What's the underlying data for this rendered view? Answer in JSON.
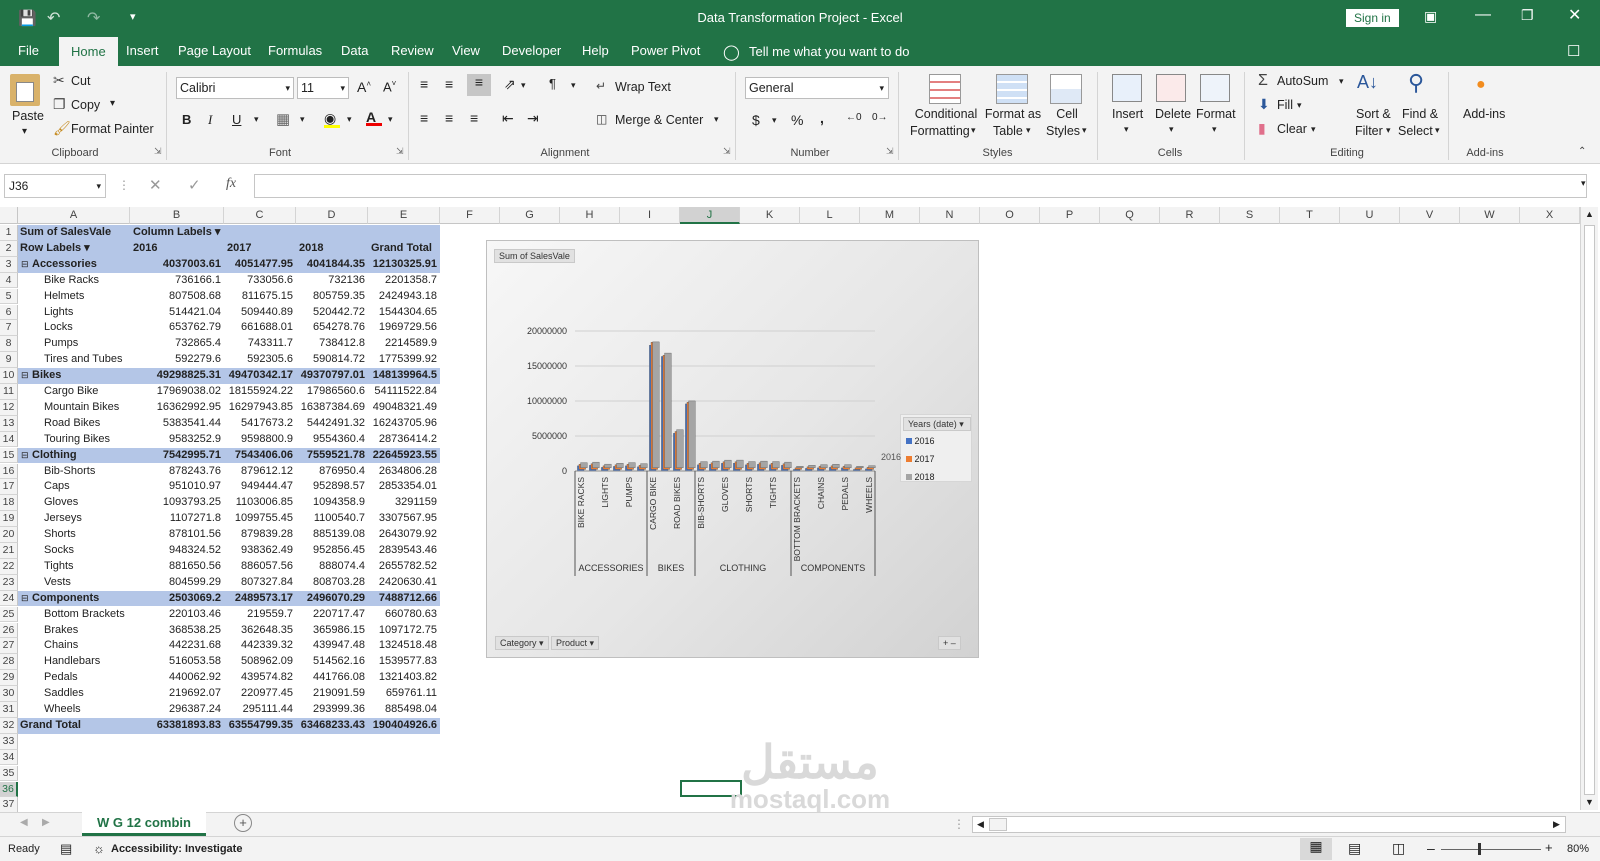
{
  "app": {
    "title": "Data Transformation Project  -  Excel",
    "signin": "Sign in"
  },
  "menu": {
    "tabs": [
      "File",
      "Home",
      "Insert",
      "Page Layout",
      "Formulas",
      "Data",
      "Review",
      "View",
      "Developer",
      "Help",
      "Power Pivot"
    ],
    "tell_me": "Tell me what you want to do"
  },
  "ribbon": {
    "clipboard": {
      "paste": "Paste",
      "cut": "Cut",
      "copy": "Copy",
      "format_painter": "Format Painter",
      "label": "Clipboard"
    },
    "font": {
      "name": "Calibri",
      "size": "11",
      "bold": "B",
      "italic": "I",
      "underline": "U",
      "label": "Font"
    },
    "alignment": {
      "wrap": "Wrap Text",
      "merge": "Merge & Center",
      "label": "Alignment"
    },
    "number": {
      "format": "General",
      "currency": "$",
      "percent": "%",
      "comma": ",",
      "label": "Number"
    },
    "styles": {
      "cond1": "Conditional",
      "cond2": "Formatting",
      "fmt1": "Format as",
      "fmt2": "Table",
      "cell1": "Cell",
      "cell2": "Styles",
      "label": "Styles"
    },
    "cells": {
      "insert": "Insert",
      "delete": "Delete",
      "format": "Format",
      "label": "Cells"
    },
    "editing": {
      "autosum": "AutoSum",
      "fill": "Fill",
      "clear": "Clear",
      "sort1": "Sort &",
      "sort2": "Filter",
      "find1": "Find &",
      "find2": "Select",
      "label": "Editing"
    },
    "addins": {
      "btn": "Add-ins",
      "label": "Add-ins"
    }
  },
  "formula": {
    "namebox": "J36",
    "fx": "fx"
  },
  "columns": [
    "A",
    "B",
    "C",
    "D",
    "E",
    "F",
    "G",
    "H",
    "I",
    "J",
    "K",
    "L",
    "M",
    "N",
    "O",
    "P",
    "Q",
    "R",
    "S",
    "T",
    "U",
    "V",
    "W",
    "X"
  ],
  "rows": [
    "1",
    "2",
    "3",
    "4",
    "5",
    "6",
    "7",
    "8",
    "9",
    "10",
    "11",
    "12",
    "13",
    "14",
    "15",
    "16",
    "17",
    "18",
    "19",
    "20",
    "21",
    "22",
    "23",
    "24",
    "25",
    "26",
    "27",
    "28",
    "29",
    "30",
    "31",
    "32",
    "33",
    "34",
    "35",
    "36",
    "37"
  ],
  "pivot": {
    "r1": [
      "Sum of SalesVale",
      "Column Labels"
    ],
    "r2": [
      "Row Labels",
      "2016",
      "2017",
      "2018",
      "Grand Total"
    ],
    "body": [
      [
        "Accessories",
        "4037003.61",
        "4051477.95",
        "4041844.35",
        "12130325.91",
        "g"
      ],
      [
        "Bike Racks",
        "736166.1",
        "733056.6",
        "732136",
        "2201358.7",
        "i"
      ],
      [
        "Helmets",
        "807508.68",
        "811675.15",
        "805759.35",
        "2424943.18",
        "i"
      ],
      [
        "Lights",
        "514421.04",
        "509440.89",
        "520442.72",
        "1544304.65",
        "i"
      ],
      [
        "Locks",
        "653762.79",
        "661688.01",
        "654278.76",
        "1969729.56",
        "i"
      ],
      [
        "Pumps",
        "732865.4",
        "743311.7",
        "738412.8",
        "2214589.9",
        "i"
      ],
      [
        "Tires and Tubes",
        "592279.6",
        "592305.6",
        "590814.72",
        "1775399.92",
        "i"
      ],
      [
        "Bikes",
        "49298825.31",
        "49470342.17",
        "49370797.01",
        "148139964.5",
        "g"
      ],
      [
        "Cargo Bike",
        "17969038.02",
        "18155924.22",
        "17986560.6",
        "54111522.84",
        "i"
      ],
      [
        "Mountain Bikes",
        "16362992.95",
        "16297943.85",
        "16387384.69",
        "49048321.49",
        "i"
      ],
      [
        "Road Bikes",
        "5383541.44",
        "5417673.2",
        "5442491.32",
        "16243705.96",
        "i"
      ],
      [
        "Touring Bikes",
        "9583252.9",
        "9598800.9",
        "9554360.4",
        "28736414.2",
        "i"
      ],
      [
        "Clothing",
        "7542995.71",
        "7543406.06",
        "7559521.78",
        "22645923.55",
        "g"
      ],
      [
        "Bib-Shorts",
        "878243.76",
        "879612.12",
        "876950.4",
        "2634806.28",
        "i"
      ],
      [
        "Caps",
        "951010.97",
        "949444.47",
        "952898.57",
        "2853354.01",
        "i"
      ],
      [
        "Gloves",
        "1093793.25",
        "1103006.85",
        "1094358.9",
        "3291159",
        "i"
      ],
      [
        "Jerseys",
        "1107271.8",
        "1099755.45",
        "1100540.7",
        "3307567.95",
        "i"
      ],
      [
        "Shorts",
        "878101.56",
        "879839.28",
        "885139.08",
        "2643079.92",
        "i"
      ],
      [
        "Socks",
        "948324.52",
        "938362.49",
        "952856.45",
        "2839543.46",
        "i"
      ],
      [
        "Tights",
        "881650.56",
        "886057.56",
        "888074.4",
        "2655782.52",
        "i"
      ],
      [
        "Vests",
        "804599.29",
        "807327.84",
        "808703.28",
        "2420630.41",
        "i"
      ],
      [
        "Components",
        "2503069.2",
        "2489573.17",
        "2496070.29",
        "7488712.66",
        "g"
      ],
      [
        "Bottom Brackets",
        "220103.46",
        "219559.7",
        "220717.47",
        "660780.63",
        "i"
      ],
      [
        "Brakes",
        "368538.25",
        "362648.35",
        "365986.15",
        "1097172.75",
        "i"
      ],
      [
        "Chains",
        "442231.68",
        "442339.32",
        "439947.48",
        "1324518.48",
        "i"
      ],
      [
        "Handlebars",
        "516053.58",
        "508962.09",
        "514562.16",
        "1539577.83",
        "i"
      ],
      [
        "Pedals",
        "440062.92",
        "439574.82",
        "441766.08",
        "1321403.82",
        "i"
      ],
      [
        "Saddles",
        "219692.07",
        "220977.45",
        "219091.59",
        "659761.11",
        "i"
      ],
      [
        "Wheels",
        "296387.24",
        "295111.44",
        "293999.36",
        "885498.04",
        "i"
      ],
      [
        "Grand Total",
        "63381893.83",
        "63554799.35",
        "63468233.43",
        "190404926.6",
        "t"
      ]
    ]
  },
  "chart_data": {
    "type": "bar",
    "title": "Sum of SalesVale",
    "categories": [
      "BIKE RACKS",
      "HELMETS",
      "LIGHTS",
      "LOCKS",
      "PUMPS",
      "TIRES AND TUBES",
      "CARGO BIKE",
      "MOUNTAIN BIKES",
      "ROAD BIKES",
      "TOURING BIKES",
      "BIB-SHORTS",
      "CAPS",
      "GLOVES",
      "JERSEYS",
      "SHORTS",
      "SOCKS",
      "TIGHTS",
      "VESTS",
      "BOTTOM BRACKETS",
      "BRAKES",
      "CHAINS",
      "HANDLEBARS",
      "PEDALS",
      "SADDLES",
      "WHEELS"
    ],
    "tick_labels": [
      "BIKE RACKS",
      "LIGHTS",
      "PUMPS",
      "CARGO BIKE",
      "ROAD BIKES",
      "BIB-SHORTS",
      "GLOVES",
      "SHORTS",
      "TIGHTS",
      "BOTTOM BRACKETS",
      "CHAINS",
      "PEDALS",
      "WHEELS"
    ],
    "groups": [
      {
        "name": "ACCESSORIES",
        "count": 6
      },
      {
        "name": "BIKES",
        "count": 4
      },
      {
        "name": "CLOTHING",
        "count": 8
      },
      {
        "name": "COMPONENTS",
        "count": 7
      }
    ],
    "series": [
      {
        "name": "2016",
        "color": "#4472c4",
        "values": [
          736166.1,
          807508.68,
          514421.04,
          653762.79,
          732865.4,
          592279.6,
          17969038.02,
          16362992.95,
          5383541.44,
          9583252.9,
          878243.76,
          951010.97,
          1093793.25,
          1107271.8,
          878101.56,
          948324.52,
          881650.56,
          804599.29,
          220103.46,
          368538.25,
          442231.68,
          516053.58,
          440062.92,
          219692.07,
          296387.24
        ]
      },
      {
        "name": "2017",
        "color": "#ed7d31",
        "values": [
          733056.6,
          811675.15,
          509440.89,
          661688.01,
          743311.7,
          592305.6,
          18155924.22,
          16297943.85,
          5417673.2,
          9598800.9,
          879612.12,
          949444.47,
          1103006.85,
          1099755.45,
          879839.28,
          938362.49,
          886057.56,
          807327.84,
          219559.7,
          362648.35,
          442339.32,
          508962.09,
          439574.82,
          220977.45,
          295111.44
        ]
      },
      {
        "name": "2018",
        "color": "#a5a5a5",
        "values": [
          732136,
          805759.35,
          520442.72,
          654278.76,
          738412.8,
          590814.72,
          17986560.6,
          16387384.69,
          5442491.32,
          9554360.4,
          876950.4,
          952898.57,
          1094358.9,
          1100540.7,
          885139.08,
          952856.45,
          888074.4,
          808703.28,
          220717.47,
          365986.15,
          439947.48,
          514562.16,
          441766.08,
          219091.59,
          293999.36
        ]
      }
    ],
    "yticks": [
      "20000000",
      "15000000",
      "10000000",
      "5000000",
      "0"
    ],
    "ylim": [
      0,
      20000000
    ],
    "legend_title": "Years (date)",
    "legend_placement": "right",
    "depth_label": "2016",
    "filter_buttons": [
      "Category",
      "Product"
    ]
  },
  "sheet": {
    "tab": "W G 12 combin",
    "add": "+"
  },
  "status": {
    "ready": "Ready",
    "accessibility": "Accessibility: Investigate",
    "zoom": "80%"
  },
  "watermark": {
    "line1": "مستقل",
    "line2": "mostaql.com"
  }
}
